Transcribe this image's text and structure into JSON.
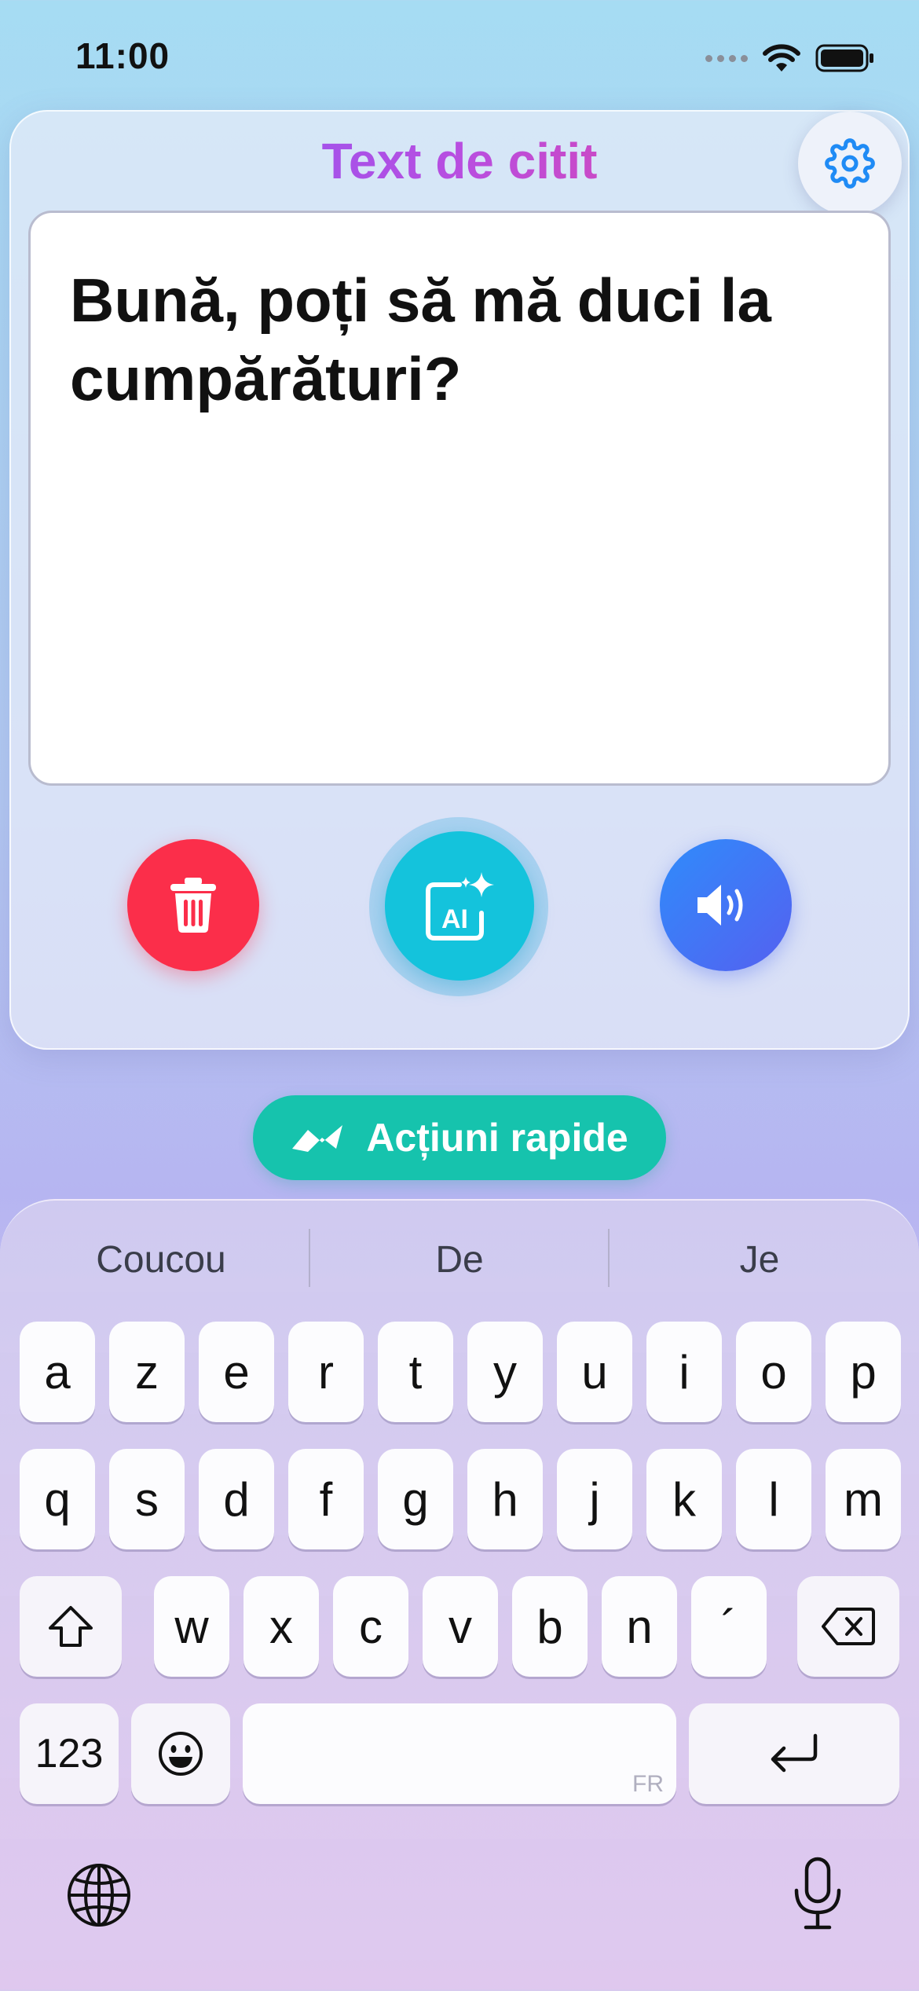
{
  "status_bar": {
    "time": "11:00"
  },
  "card": {
    "title": "Text de citit",
    "text": "Bună, poți să mă duci la cumpărături?"
  },
  "actions": {
    "delete_icon": "trash-icon",
    "ai_icon": "ai-sparkle-icon",
    "speak_icon": "speaker-icon"
  },
  "quick_actions": {
    "label": "Acțiuni rapide"
  },
  "keyboard": {
    "suggestions": [
      "Coucou",
      "De",
      "Je"
    ],
    "row1": [
      "a",
      "z",
      "e",
      "r",
      "t",
      "y",
      "u",
      "i",
      "o",
      "p"
    ],
    "row2": [
      "q",
      "s",
      "d",
      "f",
      "g",
      "h",
      "j",
      "k",
      "l",
      "m"
    ],
    "row3": [
      "w",
      "x",
      "c",
      "v",
      "b",
      "n",
      "´"
    ],
    "numbers_label": "123",
    "space_lang": "FR"
  },
  "colors": {
    "delete": "#fb2e4a",
    "ai": "#14c3dc",
    "speak": "#3f7af6",
    "quick_actions": "#16c3ad",
    "settings": "#1f8bf5"
  }
}
